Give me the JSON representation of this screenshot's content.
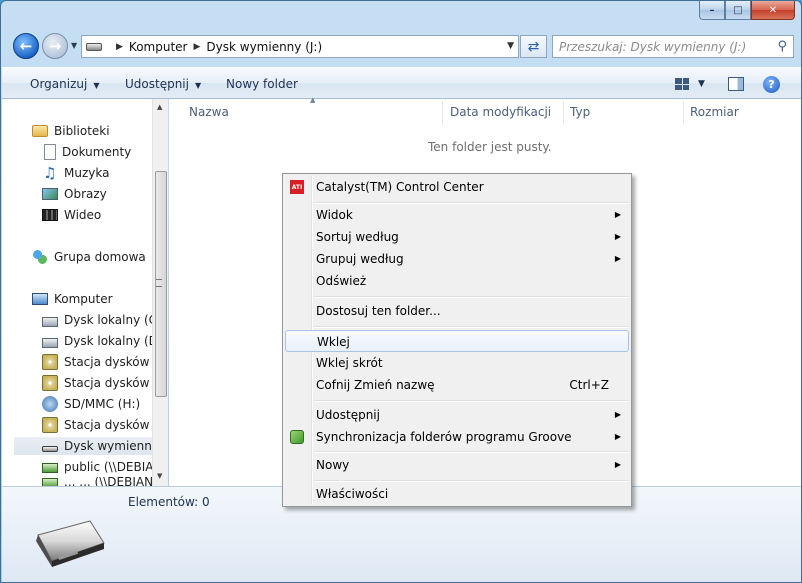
{
  "window": {
    "caption": {
      "minimize": "–",
      "maximize": "□",
      "close": "✕"
    }
  },
  "address": {
    "crumbs": [
      "Komputer",
      "Dysk wymienny (J:)"
    ]
  },
  "search": {
    "placeholder": "Przeszukaj: Dysk wymienny (J:)"
  },
  "toolbar": {
    "organize": "Organizuj",
    "share": "Udostępnij",
    "new_folder": "Nowy folder"
  },
  "navpane": {
    "items": [
      {
        "label": "Biblioteki",
        "icon": "folder-icon"
      },
      {
        "label": "Dokumenty",
        "icon": "document-icon"
      },
      {
        "label": "Muzyka",
        "icon": "music-icon"
      },
      {
        "label": "Obrazy",
        "icon": "picture-icon"
      },
      {
        "label": "Wideo",
        "icon": "video-icon"
      },
      {
        "label": "Grupa domowa",
        "icon": "homegroup-icon"
      },
      {
        "label": "Komputer",
        "icon": "computer-icon"
      },
      {
        "label": "Dysk lokalny (C:)",
        "icon": "disk-icon"
      },
      {
        "label": "Dysk lokalny (D:)",
        "icon": "disk-icon"
      },
      {
        "label": "Stacja dysków DV",
        "icon": "dvd-icon"
      },
      {
        "label": "Stacja dysków BD",
        "icon": "dvd-icon"
      },
      {
        "label": "SD/MMC (H:)",
        "icon": "sd-icon"
      },
      {
        "label": "Stacja dysków BD",
        "icon": "dvd-icon"
      },
      {
        "label": "Dysk wymienny (",
        "icon": "usb-drive-icon"
      },
      {
        "label": "public (\\\\DEBIAN",
        "icon": "network-drive-icon"
      },
      {
        "label": "... ... (\\\\DEBIAN",
        "icon": "network-drive-icon"
      }
    ]
  },
  "content": {
    "columns": [
      "Nazwa",
      "Data modyfikacji",
      "Typ",
      "Rozmiar"
    ],
    "empty_message": "Ten folder jest pusty."
  },
  "details": {
    "count": "Elementów: 0"
  },
  "context_menu": {
    "items": [
      {
        "label": "Catalyst(TM) Control Center"
      },
      {
        "label": "Widok"
      },
      {
        "label": "Sortuj według"
      },
      {
        "label": "Grupuj według"
      },
      {
        "label": "Odśwież"
      },
      {
        "label": "Dostosuj ten folder..."
      },
      {
        "label": "Wklej"
      },
      {
        "label": "Wklej skrót"
      },
      {
        "label": "Cofnij Zmień nazwę",
        "shortcut": "Ctrl+Z"
      },
      {
        "label": "Udostępnij"
      },
      {
        "label": "Synchronizacja folderów programu Groove"
      },
      {
        "label": "Nowy"
      },
      {
        "label": "Właściwości"
      }
    ],
    "ati_icon_text": "ATI"
  }
}
